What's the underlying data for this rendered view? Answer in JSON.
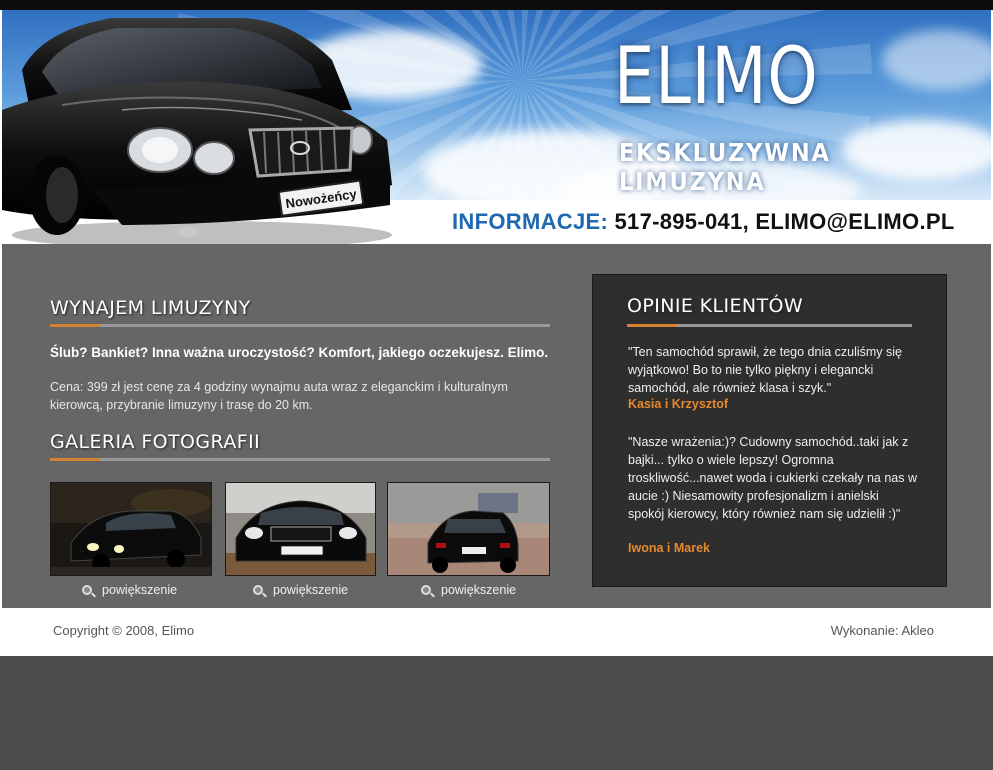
{
  "header": {
    "brand": "ELIMO",
    "tagline": "EKSKLUZYWNA LIMUZYNA",
    "info_label": "INFORMACJE:",
    "info_value": "517-895-041, ELIMO@ELIMO.PL",
    "plate_text": "Nowożeńcy"
  },
  "rental": {
    "title": "WYNAJEM LIMUZYNY",
    "lead": "Ślub? Bankiet? Inna ważna uroczystość? Komfort, jakiego oczekujesz. Elimo.",
    "price_text": "Cena: 399 zł jest cenę za 4 godziny wynajmu auta wraz z eleganckim i kulturalnym kierowcą, przybranie limuzyny i trasę do 20 km."
  },
  "gallery": {
    "title": "GALERIA FOTOGRAFII",
    "items": [
      {
        "zoom_label": "powiększenie"
      },
      {
        "zoom_label": "powiększenie"
      },
      {
        "zoom_label": "powiększenie"
      }
    ]
  },
  "opinions": {
    "title": "OPINIE KLIENTÓW",
    "items": [
      {
        "quote": "\"Ten samochód sprawił, że tego dnia czuliśmy się wyjątkowo! Bo to nie tylko piękny i elegancki samochód, ale również klasa i szyk.\"",
        "author": "Kasia i Krzysztof"
      },
      {
        "quote": "\"Nasze wrażenia:)? Cudowny samochód..taki jak z bajki... tylko o wiele lepszy! Ogromna troskliwość...nawet woda i cukierki czekały na nas w aucie :) Niesamowity profesjonalizm i anielski spokój kierowcy, który również nam się udzielił :)\"",
        "author": "Iwona i Marek"
      }
    ]
  },
  "footer": {
    "copyright": "Copyright © 2008, Elimo",
    "credit": "Wykonanie: Akleo"
  },
  "colors": {
    "accent_orange": "#e68a2e",
    "info_blue": "#1f67b1",
    "main_gray": "#666666",
    "panel_dark": "#2e2e2e"
  }
}
